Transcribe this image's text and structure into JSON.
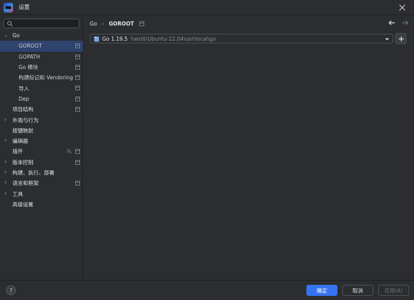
{
  "window": {
    "title": "设置",
    "icons": {
      "app": "goland-app-icon",
      "close": "close-icon"
    }
  },
  "sidebar": {
    "search_placeholder": "",
    "items": [
      {
        "label": "Go",
        "level": 0,
        "arrow": "expanded"
      },
      {
        "label": "GOROOT",
        "level": 1,
        "selected": true,
        "badge": "project-scope-icon"
      },
      {
        "label": "GOPATH",
        "level": 1,
        "badge": "project-scope-icon"
      },
      {
        "label": "Go 模块",
        "level": 1,
        "badge": "project-scope-icon"
      },
      {
        "label": "构建标记和 Vendoring",
        "level": 1,
        "badge": "project-scope-icon"
      },
      {
        "label": "导入",
        "level": 1,
        "badge": "project-scope-icon"
      },
      {
        "label": "Dep",
        "level": 1,
        "badge": "project-scope-icon"
      },
      {
        "label": "项目结构",
        "level": 0,
        "badge": "project-scope-icon"
      },
      {
        "label": "外观与行为",
        "level": 0,
        "arrow": "collapsed"
      },
      {
        "label": "按键映射",
        "level": 0
      },
      {
        "label": "编辑器",
        "level": 0,
        "arrow": "collapsed"
      },
      {
        "label": "插件",
        "level": 0,
        "badge": "project-scope-icon",
        "badge2": "translate-icon"
      },
      {
        "label": "版本控制",
        "level": 0,
        "arrow": "collapsed",
        "badge": "project-scope-icon"
      },
      {
        "label": "构建、执行、部署",
        "level": 0,
        "arrow": "collapsed"
      },
      {
        "label": "语言和框架",
        "level": 0,
        "arrow": "collapsed",
        "badge": "project-scope-icon"
      },
      {
        "label": "工具",
        "level": 0,
        "arrow": "collapsed"
      },
      {
        "label": "高级设置",
        "level": 0
      }
    ]
  },
  "content": {
    "breadcrumb": [
      "Go",
      "GOROOT"
    ],
    "sdk": {
      "name": "Go 1.19.5",
      "path": "\\\\wsl$\\Ubuntu-22.04\\usr\\local\\go"
    }
  },
  "footer": {
    "ok_label": "确定",
    "cancel_label": "取消",
    "apply_label": "应用(A)",
    "help_label": "?"
  },
  "colors": {
    "background": "#2b2d30",
    "selection": "#2e436e",
    "primary_button": "#3574f0"
  }
}
